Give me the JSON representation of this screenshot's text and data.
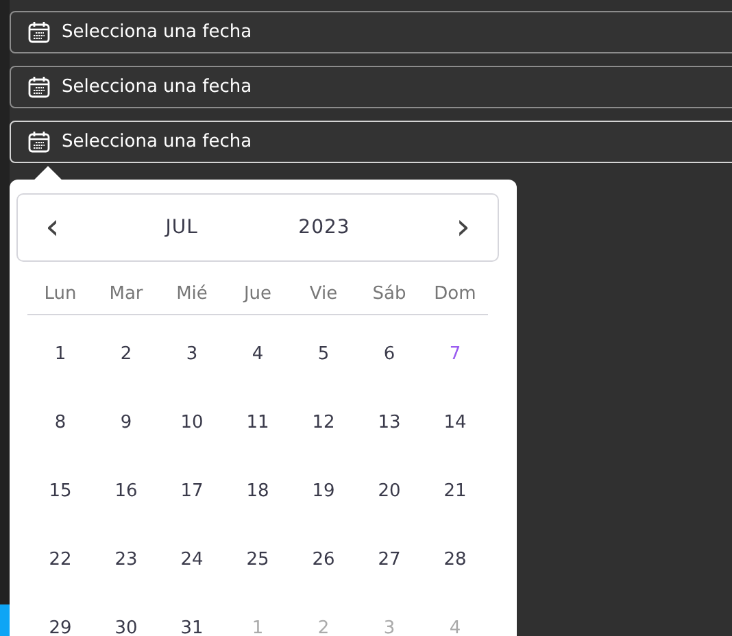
{
  "date_fields": [
    {
      "placeholder": "Selecciona una fecha",
      "expanded": false
    },
    {
      "placeholder": "Selecciona una fecha",
      "expanded": false
    },
    {
      "placeholder": "Selecciona una fecha",
      "expanded": true
    }
  ],
  "calendar": {
    "prev": "‹",
    "month": "JUL",
    "year": "2023",
    "next": "›",
    "weekdays": [
      "Lun",
      "Mar",
      "Mié",
      "Jue",
      "Vie",
      "Sáb",
      "Dom"
    ],
    "days": [
      {
        "label": "1",
        "today": false,
        "outside": false
      },
      {
        "label": "2",
        "today": false,
        "outside": false
      },
      {
        "label": "3",
        "today": false,
        "outside": false
      },
      {
        "label": "4",
        "today": false,
        "outside": false
      },
      {
        "label": "5",
        "today": false,
        "outside": false
      },
      {
        "label": "6",
        "today": false,
        "outside": false
      },
      {
        "label": "7",
        "today": true,
        "outside": false
      },
      {
        "label": "8",
        "today": false,
        "outside": false
      },
      {
        "label": "9",
        "today": false,
        "outside": false
      },
      {
        "label": "10",
        "today": false,
        "outside": false
      },
      {
        "label": "11",
        "today": false,
        "outside": false
      },
      {
        "label": "12",
        "today": false,
        "outside": false
      },
      {
        "label": "13",
        "today": false,
        "outside": false
      },
      {
        "label": "14",
        "today": false,
        "outside": false
      },
      {
        "label": "15",
        "today": false,
        "outside": false
      },
      {
        "label": "16",
        "today": false,
        "outside": false
      },
      {
        "label": "17",
        "today": false,
        "outside": false
      },
      {
        "label": "18",
        "today": false,
        "outside": false
      },
      {
        "label": "19",
        "today": false,
        "outside": false
      },
      {
        "label": "20",
        "today": false,
        "outside": false
      },
      {
        "label": "21",
        "today": false,
        "outside": false
      },
      {
        "label": "22",
        "today": false,
        "outside": false
      },
      {
        "label": "23",
        "today": false,
        "outside": false
      },
      {
        "label": "24",
        "today": false,
        "outside": false
      },
      {
        "label": "25",
        "today": false,
        "outside": false
      },
      {
        "label": "26",
        "today": false,
        "outside": false
      },
      {
        "label": "27",
        "today": false,
        "outside": false
      },
      {
        "label": "28",
        "today": false,
        "outside": false
      },
      {
        "label": "29",
        "today": false,
        "outside": false
      },
      {
        "label": "30",
        "today": false,
        "outside": false
      },
      {
        "label": "31",
        "today": false,
        "outside": false
      },
      {
        "label": "1",
        "today": false,
        "outside": true
      },
      {
        "label": "2",
        "today": false,
        "outside": true
      },
      {
        "label": "3",
        "today": false,
        "outside": true
      },
      {
        "label": "4",
        "today": false,
        "outside": true
      }
    ]
  }
}
